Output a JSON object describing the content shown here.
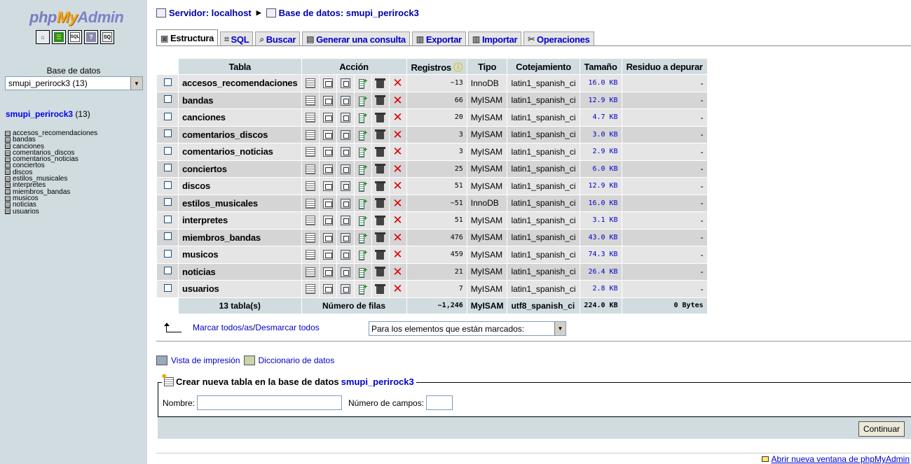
{
  "nav": {
    "logo": {
      "php": "php",
      "my": "My",
      "admin": "Admin"
    },
    "quick_icons": [
      "home-icon",
      "logout-icon",
      "sql-query-icon",
      "docs-icon",
      "sql-docs-icon"
    ],
    "db_label": "Base de datos",
    "db_select": "smupi_perirock3 (13)",
    "db_name": "smupi_perirock3",
    "db_count": " (13)",
    "tables": [
      "accesos_recomendaciones",
      "bandas",
      "canciones",
      "comentarios_discos",
      "comentarios_noticias",
      "conciertos",
      "discos",
      "estilos_musicales",
      "interpretes",
      "miembros_bandas",
      "musicos",
      "noticias",
      "usuarios"
    ]
  },
  "breadcrumb": {
    "server": "Servidor: localhost",
    "database": "Base de datos: smupi_perirock3"
  },
  "tabs": [
    "Estructura",
    "SQL",
    "Buscar",
    "Generar una consulta",
    "Exportar",
    "Importar",
    "Operaciones"
  ],
  "table": {
    "headers": {
      "tabla": "Tabla",
      "accion": "Acción",
      "registros": "Registros",
      "tipo": "Tipo",
      "cotejamiento": "Cotejamiento",
      "tamano": "Tamaño",
      "residuo": "Residuo a depurar"
    },
    "rows": [
      {
        "name": "accesos_recomendaciones",
        "records": "~13",
        "type": "InnoDB",
        "collation": "latin1_spanish_ci",
        "size": "16.0 KB",
        "overhead": "-"
      },
      {
        "name": "bandas",
        "records": "66",
        "type": "MyISAM",
        "collation": "latin1_spanish_ci",
        "size": "12.9 KB",
        "overhead": "-"
      },
      {
        "name": "canciones",
        "records": "20",
        "type": "MyISAM",
        "collation": "latin1_spanish_ci",
        "size": "4.7 KB",
        "overhead": "-"
      },
      {
        "name": "comentarios_discos",
        "records": "3",
        "type": "MyISAM",
        "collation": "latin1_spanish_ci",
        "size": "3.0 KB",
        "overhead": "-"
      },
      {
        "name": "comentarios_noticias",
        "records": "3",
        "type": "MyISAM",
        "collation": "latin1_spanish_ci",
        "size": "2.9 KB",
        "overhead": "-"
      },
      {
        "name": "conciertos",
        "records": "25",
        "type": "MyISAM",
        "collation": "latin1_spanish_ci",
        "size": "6.0 KB",
        "overhead": "-"
      },
      {
        "name": "discos",
        "records": "51",
        "type": "MyISAM",
        "collation": "latin1_spanish_ci",
        "size": "12.9 KB",
        "overhead": "-"
      },
      {
        "name": "estilos_musicales",
        "records": "~51",
        "type": "InnoDB",
        "collation": "latin1_spanish_ci",
        "size": "16.0 KB",
        "overhead": "-"
      },
      {
        "name": "interpretes",
        "records": "51",
        "type": "MyISAM",
        "collation": "latin1_spanish_ci",
        "size": "3.1 KB",
        "overhead": "-"
      },
      {
        "name": "miembros_bandas",
        "records": "476",
        "type": "MyISAM",
        "collation": "latin1_spanish_ci",
        "size": "43.0 KB",
        "overhead": "-"
      },
      {
        "name": "musicos",
        "records": "459",
        "type": "MyISAM",
        "collation": "latin1_spanish_ci",
        "size": "74.3 KB",
        "overhead": "-"
      },
      {
        "name": "noticias",
        "records": "21",
        "type": "MyISAM",
        "collation": "latin1_spanish_ci",
        "size": "26.4 KB",
        "overhead": "-"
      },
      {
        "name": "usuarios",
        "records": "7",
        "type": "MyISAM",
        "collation": "latin1_spanish_ci",
        "size": "2.8 KB",
        "overhead": "-"
      }
    ],
    "summary": {
      "tables": "13 tabla(s)",
      "label": "Número de filas",
      "records": "~1,246",
      "type": "MyISAM",
      "collation": "utf8_spanish_ci",
      "size": "224.0 KB",
      "overhead": "0 Bytes"
    }
  },
  "mark": {
    "check_all": "Marcar todos/as",
    "separator": " / ",
    "uncheck_all": "Desmarcar todos",
    "with_selected": "Para los elementos que están marcados:"
  },
  "links": {
    "print_view": "Vista de impresión",
    "data_dict": "Diccionario de datos"
  },
  "create": {
    "legend": "Crear nueva tabla en la base de datos",
    "db": "smupi_perirock3",
    "name_label": "Nombre:",
    "fields_label": "Número de campos:",
    "name_value": "",
    "fields_value": "",
    "submit": "Continuar"
  },
  "footer": {
    "new_window": "Abrir nueva ventana de phpMyAdmin"
  }
}
